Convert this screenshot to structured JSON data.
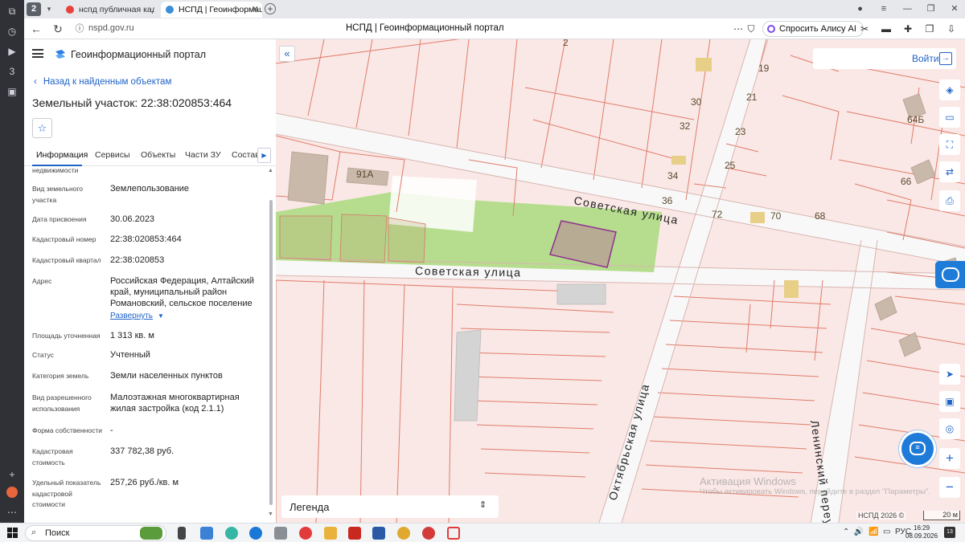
{
  "colors": {
    "accent": "#1f63c9",
    "parcel_fill": "#fae8e6",
    "parcel_stroke": "#e07c6a",
    "green_zone": "#b6dd8e",
    "selected_fill": "#b7ab94",
    "selected_stroke": "#8f2f8f"
  },
  "browser": {
    "tab_count": "2",
    "tabs": [
      {
        "label": "нспд публичная кадастр"
      },
      {
        "label": "НСПД | Геоинформаци"
      }
    ],
    "url": "nspd.gov.ru",
    "page_title": "НСПД | Геоинформационный портал",
    "alice_button": "Спросить Алису AI"
  },
  "panel": {
    "portal_name": "Геоинформационный портал",
    "back_link": "Назад к найденным объектам",
    "title": "Земельный участок: 22:38:020853:464",
    "tabs": [
      "Информация",
      "Сервисы",
      "Объекты",
      "Части ЗУ",
      "Состав"
    ],
    "fields": [
      {
        "label": "недвижимости",
        "value": ""
      },
      {
        "label": "Вид земельного участка",
        "value": "Землепользование"
      },
      {
        "label": "Дата присвоения",
        "value": "30.06.2023"
      },
      {
        "label": "Кадастровый номер",
        "value": "22:38:020853:464"
      },
      {
        "label": "Кадастровый квартал",
        "value": "22:38:020853"
      },
      {
        "label": "Адрес",
        "value": "Российская Федерация, Алтайский край, муниципальный район Романовский, сельское поселение"
      },
      {
        "label": "Площадь уточненная",
        "value": "1 313 кв. м"
      },
      {
        "label": "Статус",
        "value": "Учтенный"
      },
      {
        "label": "Категория земель",
        "value": "Земли населенных пунктов"
      },
      {
        "label": "Вид разрешенного использования",
        "value": "Малоэтажная многоквартирная жилая застройка (код 2.1.1)"
      },
      {
        "label": "Форма собственности",
        "value": "-"
      },
      {
        "label": "Кадастровая стоимость",
        "value": "337 782,38 руб."
      },
      {
        "label": "Удельный показатель кадастровой стоимости",
        "value": "257,26 руб./кв. м"
      }
    ],
    "expand_link": "Развернуть"
  },
  "map": {
    "login_label": "Войти",
    "legend_label": "Легенда",
    "copyright": "НСПД 2026 ©",
    "scale_label": "20 м",
    "watermark_title": "Активация Windows",
    "watermark_text": "Чтобы активировать Windows, перейдите в раздел \"Параметры\".",
    "street_labels": [
      "Советская улица",
      "Советская улица",
      "Октябрьская улица",
      "Ленинский переу"
    ],
    "house_numbers": [
      "2",
      "19",
      "30",
      "21",
      "32",
      "23",
      "64Б",
      "91А",
      "25",
      "34",
      "66",
      "36",
      "72",
      "70",
      "68"
    ],
    "tools": [
      "layers-icon",
      "ruler-icon",
      "select-area-icon",
      "share-icon",
      "print-icon",
      "navigate-icon",
      "minimap-icon",
      "location-icon",
      "zoom-in-icon",
      "zoom-out-icon"
    ]
  },
  "taskbar": {
    "search_placeholder": "Поиск",
    "language": "РУС",
    "time": "16:29",
    "date": "08.09.2026",
    "notification_count": "13"
  }
}
